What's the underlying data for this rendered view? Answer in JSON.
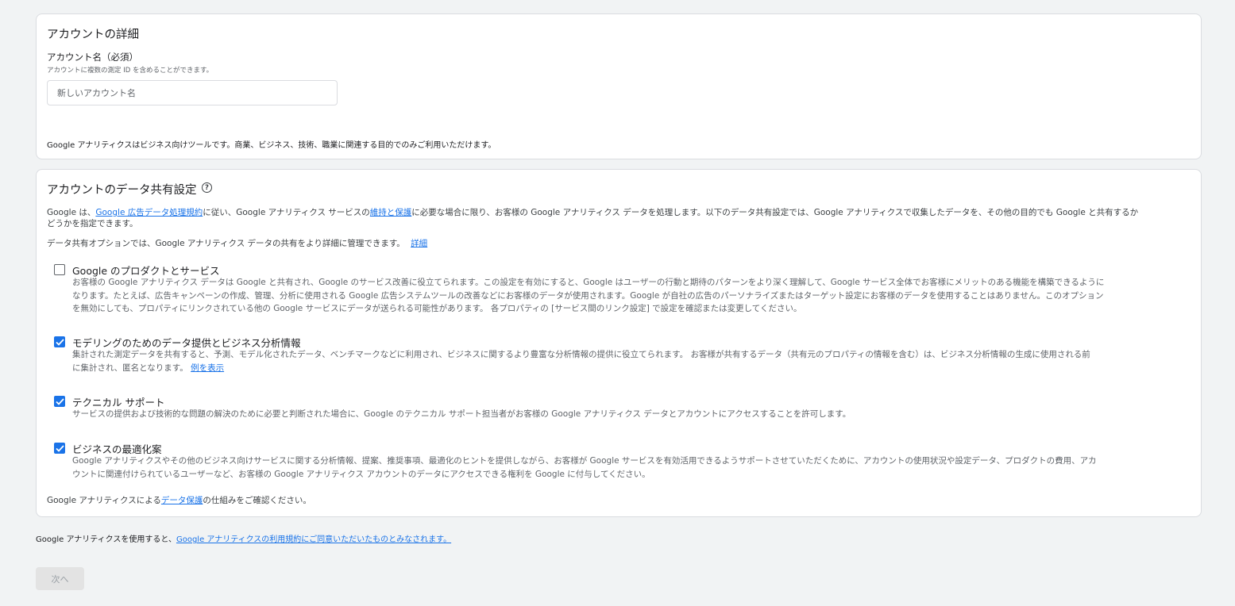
{
  "account_details": {
    "heading": "アカウントの詳細",
    "name_label": "アカウント名（必須）",
    "name_hint": "アカウントに複数の測定 ID を含めることができます。",
    "name_placeholder": "新しいアカウント名",
    "business_notice": "Google アナリティクスはビジネス向けツールです。商業、ビジネス、技術、職業に関連する目的でのみご利用いただけます。"
  },
  "data_sharing": {
    "heading": "アカウントのデータ共有設定",
    "help_icon": "help-circle-icon",
    "intro_part1": "Google は、",
    "intro_link1": "Google 広告データ処理規約",
    "intro_part2": "に従い、Google アナリティクス サービスの",
    "intro_link2": "維持と保護",
    "intro_part3": "に必要な場合に限り、お客様の Google アナリティクス データを処理します。以下のデータ共有設定では、Google アナリティクスで収集したデータを、その他の目的でも Google と共有するか",
    "intro_line2": "どうかを指定できます。",
    "options_note": "データ共有オプションでは、Google アナリティクス データの共有をより詳細に管理できます。",
    "options_note_link": "詳細",
    "options": [
      {
        "title": "Google のプロダクトとサービス",
        "checked": false,
        "lines": [
          "お客様の Google アナリティクス データは Google と共有され、Google のサービス改善に役立てられます。この設定を有効にすると、Google はユーザーの行動と期待のパターンをより深く理解して、Google サービス全体でお客様にメリットのある機能を構築できるように",
          "なります。たとえば、広告キャンペーンの作成、管理、分析に使用される Google 広告システムツールの改善などにお客様のデータが使用されます。Google が自社の広告のパーソナライズまたはターゲット設定にお客様のデータを使用することはありません。このオプション",
          "を無効にしても、プロパティにリンクされている他の Google サービスにデータが送られる可能性があります。 各プロパティの [サービス間のリンク設定] で設定を確認または変更してください。"
        ]
      },
      {
        "title": "モデリングのためのデータ提供とビジネス分析情報",
        "checked": true,
        "lines": [
          "集計された測定データを共有すると、予測、モデル化されたデータ、ベンチマークなどに利用され、ビジネスに関するより豊富な分析情報の提供に役立てられます。 お客様が共有するデータ（共有元のプロパティの情報を含む）は、ビジネス分析情報の生成に使用される前",
          "に集計され、匿名となります。"
        ],
        "link": "例を表示"
      },
      {
        "title": "テクニカル サポート",
        "checked": true,
        "lines": [
          "サービスの提供および技術的な問題の解決のために必要と判断された場合に、Google のテクニカル サポート担当者がお客様の Google アナリティクス データとアカウントにアクセスすることを許可します。"
        ]
      },
      {
        "title": "ビジネスの最適化案",
        "checked": true,
        "lines": [
          "Google アナリティクスやその他のビジネス向けサービスに関する分析情報、提案、推奨事項、最適化のヒントを提供しながら、お客様が Google サービスを有効活用できるようサポートさせていただくために、アカウントの使用状況や設定データ、プロダクトの費用、アカ",
          "ウントに関連付けられているユーザーなど、お客様の Google アナリティクス アカウントのデータにアクセスできる権利を Google に付与してください。"
        ]
      }
    ],
    "footer_part1": "Google アナリティクスによる",
    "footer_link": "データ保護",
    "footer_part2": "の仕組みをご確認ください。"
  },
  "terms": {
    "prefix": "Google アナリティクスを使用すると、",
    "link": "Google アナリティクスの利用規約にご同意いただいたものとみなされます。"
  },
  "next_button": "次へ",
  "colors": {
    "accent": "#1a73e8",
    "background": "#f1f3f4",
    "disabled_button": "#e3e3e3"
  }
}
